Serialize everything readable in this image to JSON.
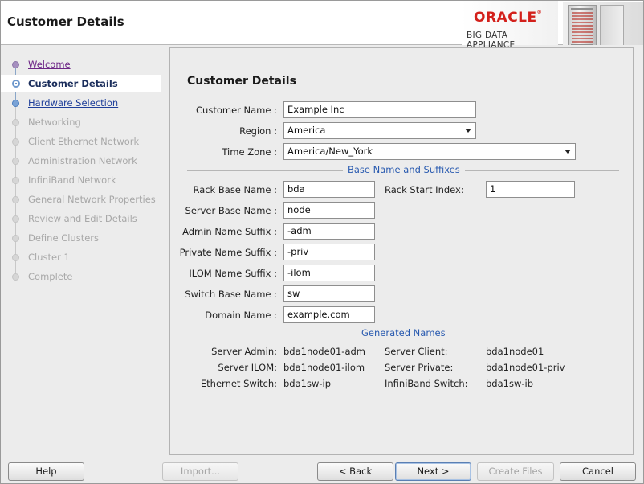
{
  "header": {
    "title": "Customer Details",
    "brand": "ORACLE",
    "brand_sub": "BIG DATA APPLIANCE"
  },
  "nav": {
    "items": [
      {
        "label": "Welcome",
        "state": "visited"
      },
      {
        "label": "Customer Details",
        "state": "current"
      },
      {
        "label": "Hardware Selection",
        "state": "link"
      },
      {
        "label": "Networking",
        "state": "disabled"
      },
      {
        "label": "Client Ethernet Network",
        "state": "disabled"
      },
      {
        "label": "Administration Network",
        "state": "disabled"
      },
      {
        "label": "InfiniBand Network",
        "state": "disabled"
      },
      {
        "label": "General Network Properties",
        "state": "disabled"
      },
      {
        "label": "Review and Edit Details",
        "state": "disabled"
      },
      {
        "label": "Define Clusters",
        "state": "disabled"
      },
      {
        "label": "Cluster 1",
        "state": "disabled"
      },
      {
        "label": "Complete",
        "state": "disabled"
      }
    ]
  },
  "form": {
    "title": "Customer Details",
    "customer_name": {
      "label": "Customer Name :",
      "value": "Example Inc"
    },
    "region": {
      "label": "Region :",
      "value": "America"
    },
    "time_zone": {
      "label": "Time Zone :",
      "value": "America/New_York"
    },
    "section_base": "Base Name and Suffixes",
    "rack_base_name": {
      "label": "Rack Base Name :",
      "value": "bda"
    },
    "rack_start_index": {
      "label": "Rack Start Index:",
      "value": "1"
    },
    "server_base_name": {
      "label": "Server Base Name :",
      "value": "node"
    },
    "admin_name_suffix": {
      "label": "Admin Name Suffix :",
      "value": "-adm"
    },
    "private_name_suffix": {
      "label": "Private Name Suffix :",
      "value": "-priv"
    },
    "ilom_name_suffix": {
      "label": "ILOM Name Suffix :",
      "value": "-ilom"
    },
    "switch_base_name": {
      "label": "Switch Base Name :",
      "value": "sw"
    },
    "domain_name": {
      "label": "Domain Name :",
      "value": "example.com"
    },
    "section_generated": "Generated Names",
    "generated": {
      "server_admin": {
        "label": "Server Admin:",
        "value": "bda1node01-adm"
      },
      "server_client": {
        "label": "Server Client:",
        "value": "bda1node01"
      },
      "server_ilom": {
        "label": "Server ILOM:",
        "value": "bda1node01-ilom"
      },
      "server_private": {
        "label": "Server Private:",
        "value": "bda1node01-priv"
      },
      "ethernet_switch": {
        "label": "Ethernet Switch:",
        "value": "bda1sw-ip"
      },
      "infiniband_switch": {
        "label": "InfiniBand Switch:",
        "value": "bda1sw-ib"
      }
    }
  },
  "buttons": {
    "help": "Help",
    "import": "Import...",
    "back": "< Back",
    "next": "Next >",
    "create_files": "Create Files",
    "cancel": "Cancel"
  }
}
